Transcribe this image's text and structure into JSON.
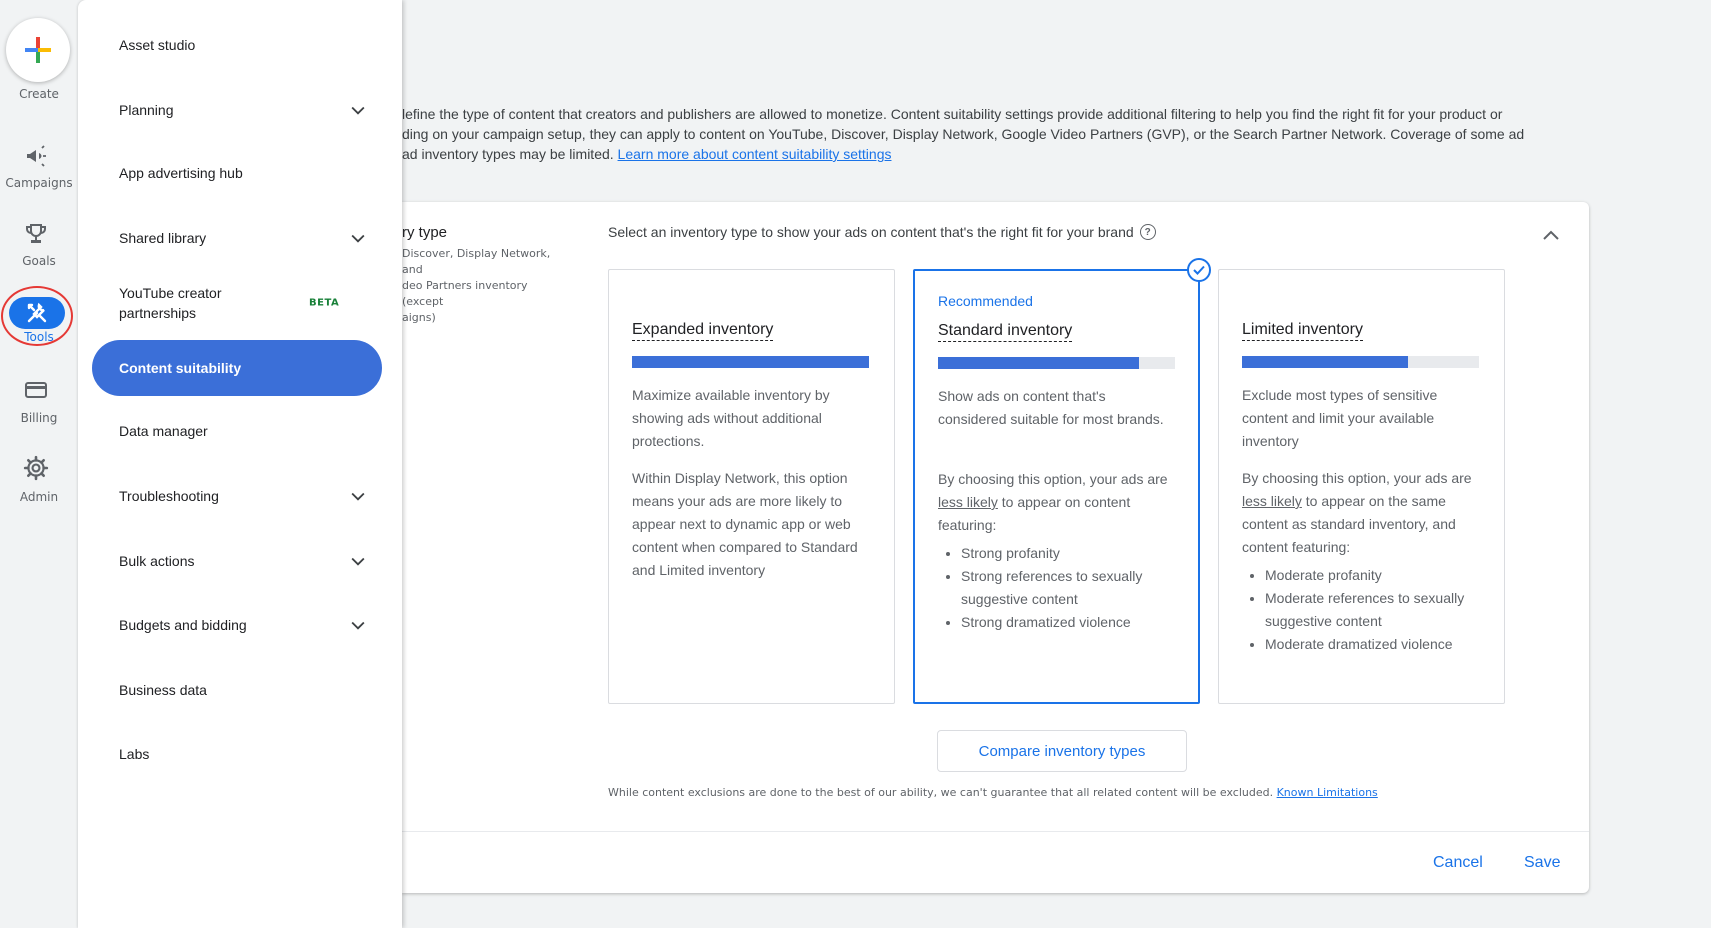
{
  "rail": {
    "create": "Create",
    "items": [
      {
        "label": "Campaigns",
        "icon": "megaphone-icon"
      },
      {
        "label": "Goals",
        "icon": "trophy-icon"
      },
      {
        "label": "Tools",
        "icon": "tools-icon"
      },
      {
        "label": "Billing",
        "icon": "credit-card-icon"
      },
      {
        "label": "Admin",
        "icon": "gear-icon"
      }
    ]
  },
  "menu": {
    "items": [
      {
        "label": "Asset studio",
        "expandable": false
      },
      {
        "label": "Planning",
        "expandable": true
      },
      {
        "label": "App advertising hub",
        "expandable": false
      },
      {
        "label": "Shared library",
        "expandable": true
      },
      {
        "label": "YouTube creator partnerships",
        "badge": "BETA",
        "expandable": false
      },
      {
        "label": "Content suitability",
        "active": true,
        "expandable": false
      },
      {
        "label": "Data manager",
        "expandable": false
      },
      {
        "label": "Troubleshooting",
        "expandable": true
      },
      {
        "label": "Bulk actions",
        "expandable": true
      },
      {
        "label": "Budgets and bidding",
        "expandable": true
      },
      {
        "label": "Business data",
        "expandable": false
      },
      {
        "label": "Labs",
        "expandable": false
      }
    ]
  },
  "intro": {
    "line1": "lefine the type of content that creators and publishers are allowed to monetize. Content suitability settings provide additional filtering to help you find the right fit for your product or",
    "line2": "ding on your campaign setup, they can apply to content on YouTube, Discover, Display Network, Google Video Partners (GVP), or the Search Partner Network. Coverage of some ad",
    "line3": "ad inventory types may be limited.",
    "link": "Learn more about content suitability settings"
  },
  "card": {
    "left_title": "ry type",
    "left_desc_1": "Discover, Display Network, and",
    "left_desc_2": "deo Partners inventory (except",
    "left_desc_3": "aigns)",
    "prompt": "Select an inventory type to show your ads on content that's the right fit for your brand",
    "options": [
      {
        "name": "Expanded inventory",
        "fill": 1.0,
        "desc": "Maximize available inventory by showing ads without additional protections.",
        "desc2": "Within Display Network, this option means your ads are more likely to appear next to dynamic app or web content when compared to Standard and Limited inventory"
      },
      {
        "recommended": "Recommended",
        "name": "Standard inventory",
        "fill": 0.85,
        "desc": "Show ads on content that's considered suitable for most brands.",
        "desc2_pre": "By choosing this option, your ads are ",
        "desc2_u": "less likely",
        "desc2_post": " to appear on content featuring:",
        "bullets": [
          "Strong profanity",
          "Strong references to sexually suggestive content",
          "Strong dramatized violence"
        ]
      },
      {
        "name": "Limited inventory",
        "fill": 0.7,
        "desc": "Exclude most types of sensitive content and limit your available inventory",
        "desc2_pre": "By choosing this option, your ads are ",
        "desc2_u": "less likely",
        "desc2_post": " to appear on the same content as standard inventory, and content featuring:",
        "bullets": [
          "Moderate profanity",
          "Moderate references to sexually suggestive content",
          "Moderate dramatized violence"
        ]
      }
    ],
    "compare": "Compare inventory types",
    "disclaimer": "While content exclusions are done to the best of our ability, we can't guarantee that all related content will be excluded.",
    "disclaimer_link": "Known Limitations",
    "cancel": "Cancel",
    "save": "Save"
  },
  "colors": {
    "accent": "#1a73e8",
    "active_menu": "#3b6fd8",
    "beta": "#188038",
    "highlight_ring": "#e53935"
  }
}
